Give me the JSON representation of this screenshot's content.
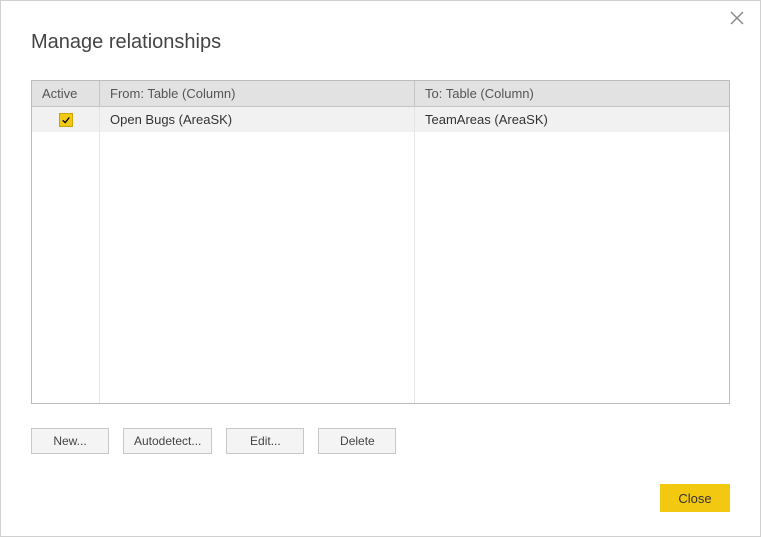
{
  "title": "Manage relationships",
  "columns": {
    "active": "Active",
    "from": "From: Table (Column)",
    "to": "To: Table (Column)"
  },
  "rows": [
    {
      "active": true,
      "from": "Open Bugs (AreaSK)",
      "to": "TeamAreas (AreaSK)"
    }
  ],
  "buttons": {
    "new": "New...",
    "autodetect": "Autodetect...",
    "edit": "Edit...",
    "delete": "Delete",
    "close": "Close"
  }
}
